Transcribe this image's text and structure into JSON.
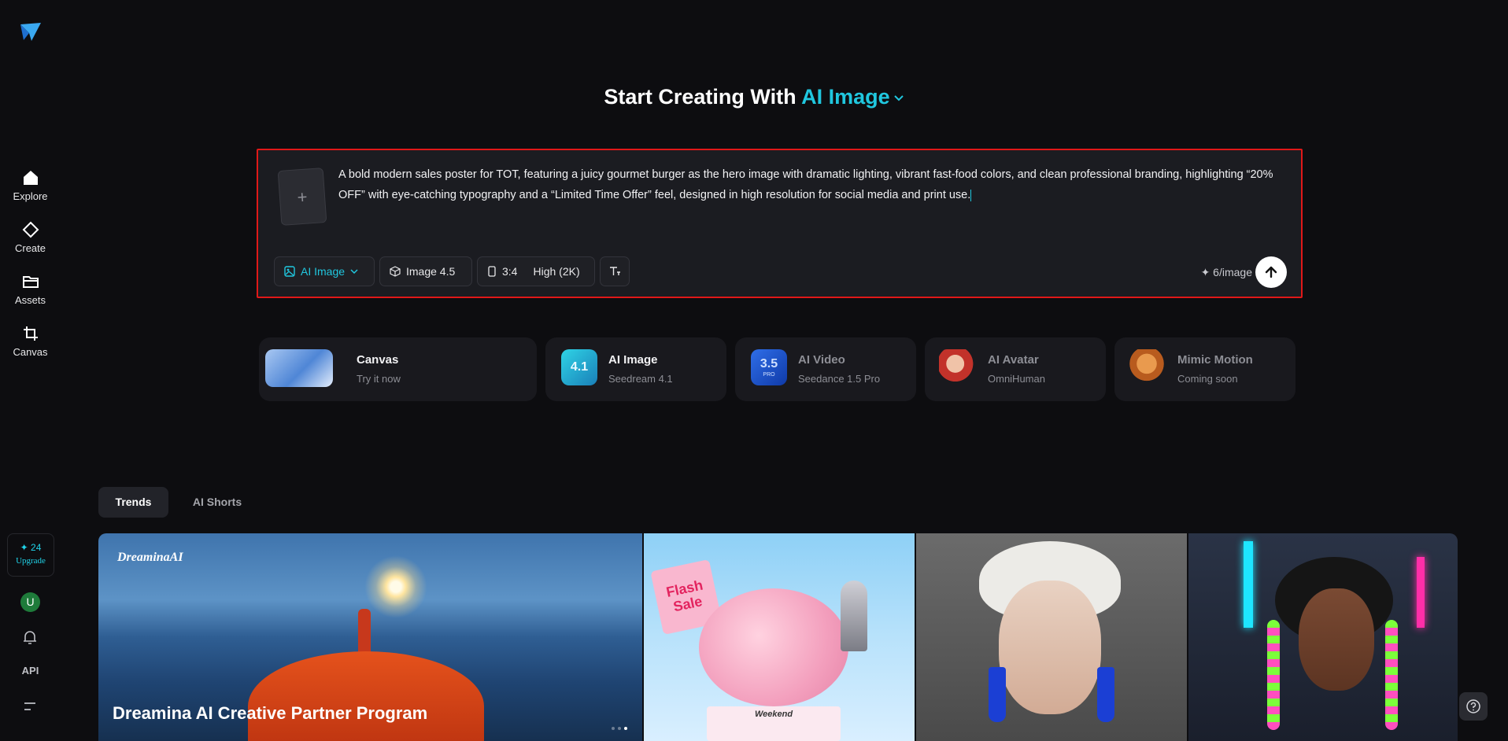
{
  "sidebar": {
    "nav": [
      {
        "label": "Explore",
        "icon": "home-icon"
      },
      {
        "label": "Create",
        "icon": "diamond-icon"
      },
      {
        "label": "Assets",
        "icon": "folder-icon"
      },
      {
        "label": "Canvas",
        "icon": "crop-icon"
      }
    ],
    "credits": "✦ 24",
    "upgrade": "Upgrade",
    "avatar_letter": "U",
    "api": "API"
  },
  "heading": {
    "prefix": "Start Creating With",
    "mode": "AI Image"
  },
  "prompt": {
    "text": "A bold modern sales poster for TOT, featuring a juicy gourmet burger as the hero image with dramatic lighting, vibrant fast-food colors, and clean professional branding, highlighting “20% OFF” with eye-catching typography and a “Limited Time Offer” feel, designed in high resolution for social media and print use.",
    "add_reference": "+",
    "chips": {
      "type": "AI Image",
      "model": "Image 4.5",
      "ratio": "3:4",
      "quality": "High (2K)"
    },
    "cost": "✦ 6/image"
  },
  "cards": [
    {
      "title": "Canvas",
      "subtitle": "Try it now"
    },
    {
      "title": "AI Image",
      "subtitle": "Seedream 4.1",
      "badge": "4.1"
    },
    {
      "title": "AI Video",
      "subtitle": "Seedance 1.5 Pro",
      "badge": "3.5",
      "badge_sub": "PRO"
    },
    {
      "title": "AI Avatar",
      "subtitle": "OmniHuman"
    },
    {
      "title": "Mimic Motion",
      "subtitle": "Coming soon"
    }
  ],
  "tabs": [
    "Trends",
    "AI Shorts"
  ],
  "gallery": {
    "brand": "DreaminaAI",
    "banner_title": "Dreamina AI Creative Partner Program",
    "flash_sale": "Flash Sale",
    "weekend": "Weekend"
  },
  "colors": {
    "accent": "#20c7df",
    "background": "#0d0d10",
    "highlight_border": "#e01818"
  }
}
